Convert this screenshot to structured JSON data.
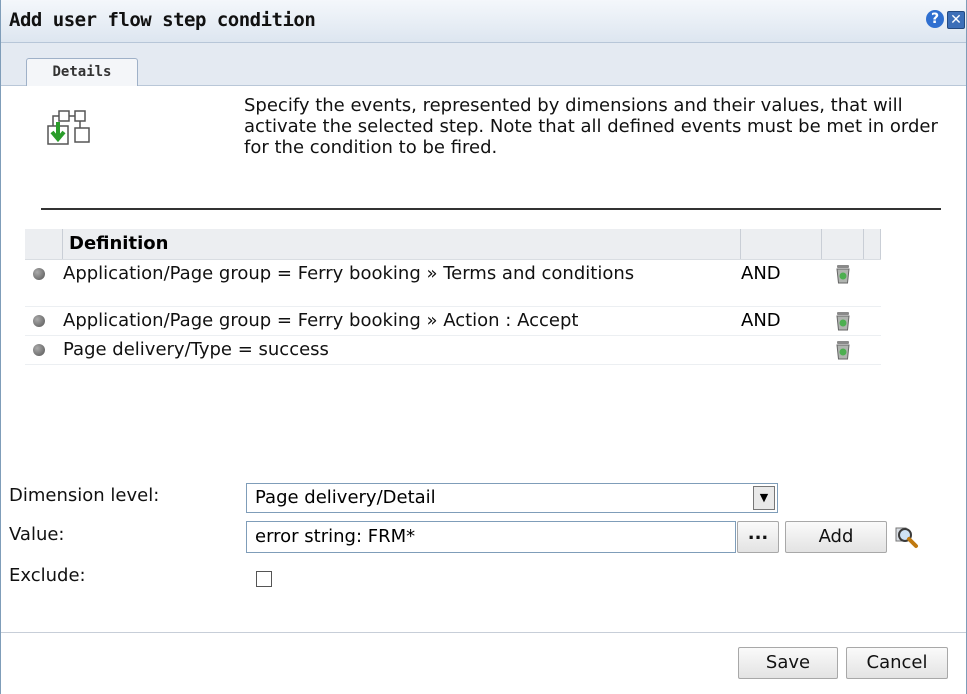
{
  "dialog": {
    "title": "Add user flow step condition",
    "help_icon": "question-icon",
    "close_icon": "close-icon"
  },
  "tabs": [
    {
      "label": "Details",
      "active": true
    }
  ],
  "intro": {
    "icon": "flow-step-icon",
    "text": "Specify the events, represented by dimensions and their values, that will activate the selected step. Note that all defined events must be met in order for the condition to be fired."
  },
  "table": {
    "header": {
      "definition": "Definition"
    },
    "rows": [
      {
        "definition": "Application/Page group = Ferry booking » Terms and conditions",
        "operator": "AND"
      },
      {
        "definition": "Application/Page group = Ferry booking » Action : Accept",
        "operator": "AND"
      },
      {
        "definition": "Page delivery/Type = success",
        "operator": ""
      }
    ]
  },
  "form": {
    "dimension_level_label": "Dimension level:",
    "dimension_level_value": "Page delivery/Detail",
    "value_label": "Value:",
    "value_input": "error string: FRM*",
    "browse_button": "...",
    "add_button": "Add",
    "exclude_label": "Exclude:",
    "exclude_checked": false
  },
  "footer": {
    "save": "Save",
    "cancel": "Cancel"
  },
  "colors": {
    "titlebar": "#dde6f0",
    "border": "#7f9db9",
    "accent": "#2f6fd0"
  }
}
